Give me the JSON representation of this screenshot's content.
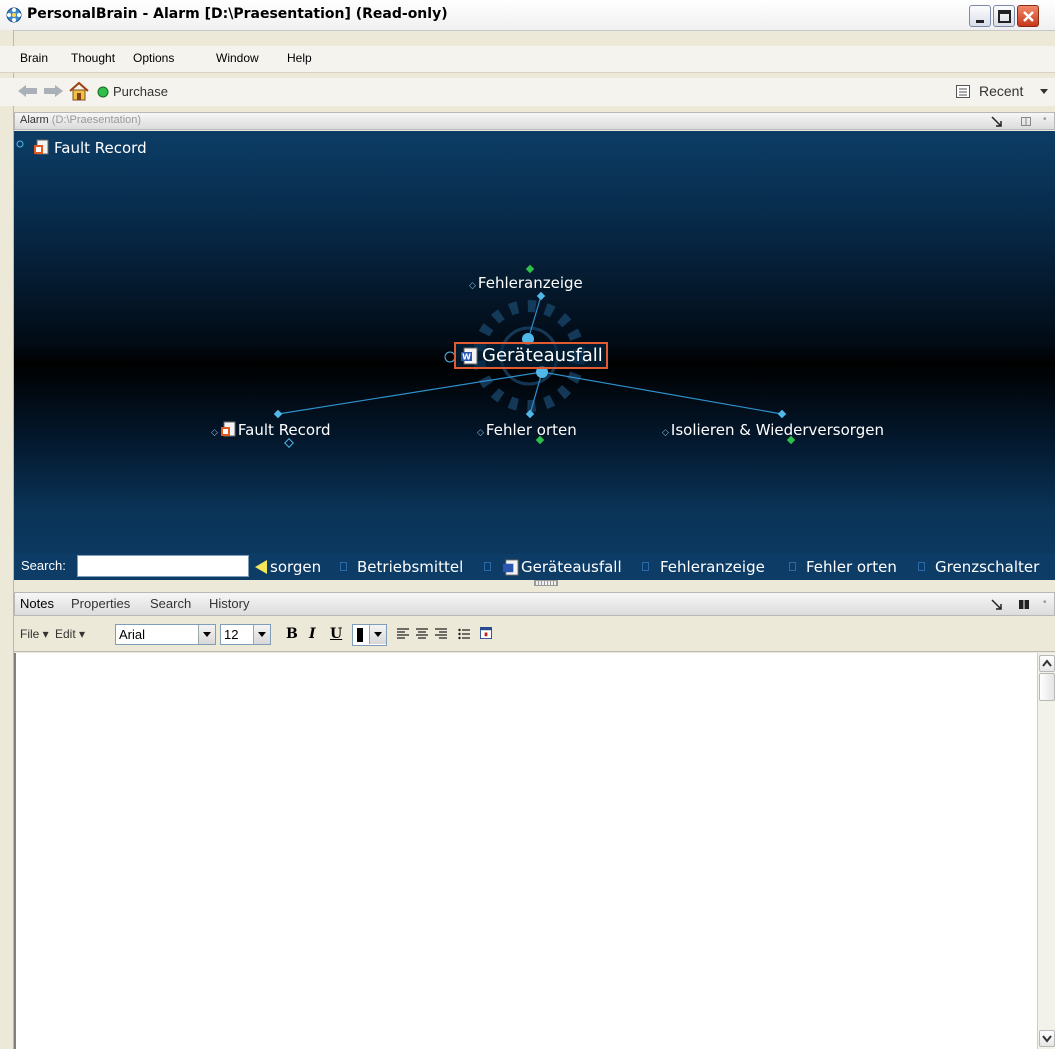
{
  "window": {
    "title": "PersonalBrain - Alarm [D:\\Praesentation] (Read-only)"
  },
  "menubar": {
    "items": [
      "Brain",
      "Thought",
      "Options",
      "Window",
      "Help"
    ]
  },
  "toolbar": {
    "purchase_label": "Purchase",
    "recent_label": "Recent"
  },
  "brain_header": {
    "name": "Alarm",
    "path": "(D:\\Praesentation)"
  },
  "plex": {
    "pinned_top": "Fault Record",
    "central": "Geräteausfall",
    "parent": "Fehleranzeige",
    "children": [
      "Fault Record",
      "Fehler orten",
      "Isolieren & Wiederversorgen"
    ]
  },
  "search": {
    "label": "Search:",
    "value": "",
    "history": [
      "sorgen",
      "Betriebsmittel",
      "Geräteausfall",
      "Fehleranzeige",
      "Fehler orten",
      "Grenzschalter"
    ]
  },
  "notes": {
    "tabs": [
      "Notes",
      "Properties",
      "Search",
      "History"
    ],
    "file_menu": "File",
    "edit_menu": "Edit",
    "font": "Arial",
    "font_size": "12",
    "bold": "B",
    "italic": "I",
    "underline": "U"
  },
  "colors": {
    "plex_background": "#0d3c66",
    "link_line": "#2f90cc",
    "node_dot": "#4fb8e8",
    "gate_green": "#2ec04a",
    "central_border": "#e05a32",
    "history_arrow": "#f2e65a"
  }
}
